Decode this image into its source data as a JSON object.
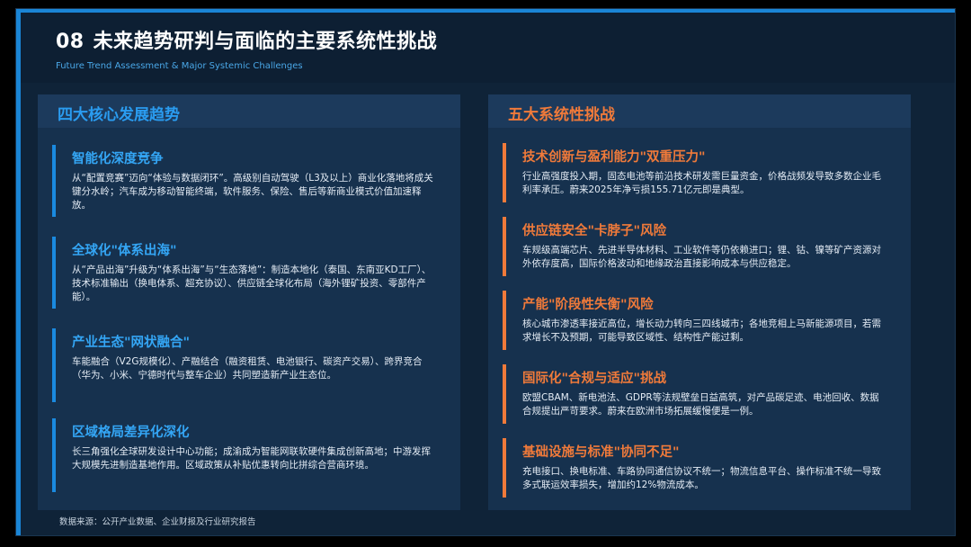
{
  "header": {
    "number": "08",
    "title": "未来趋势研判与面临的主要系统性挑战",
    "subtitle": "Future Trend Assessment & Major Systemic Challenges"
  },
  "trends": {
    "title": "四大核心发展趋势",
    "items": [
      {
        "title": "智能化深度竞争",
        "desc": "从“配置竞赛”迈向“体验与数据闭环”。高级别自动驾驶（L3及以上）商业化落地将成关键分水岭；汽车成为移动智能终端，软件服务、保险、售后等新商业模式价值加速释放。"
      },
      {
        "title": "全球化\"体系出海\"",
        "desc": "从“产品出海”升级为“体系出海”与“生态落地”：制造本地化（泰国、东南亚KD工厂）、技术标准输出（换电体系、超充协议）、供应链全球化布局（海外锂矿投资、零部件产能）。"
      },
      {
        "title": "产业生态\"网状融合\"",
        "desc": "车能融合（V2G规模化）、产融结合（融资租赁、电池银行、碳资产交易）、跨界竞合（华为、小米、宁德时代与整车企业）共同塑造新产业生态位。"
      },
      {
        "title": "区域格局差异化深化",
        "desc": "长三角强化全球研发设计中心功能；成渝成为智能网联软硬件集成创新高地；中游发挥大规模先进制造基地作用。区域政策从补贴优惠转向比拼综合营商环境。"
      }
    ]
  },
  "challenges": {
    "title": "五大系统性挑战",
    "items": [
      {
        "title": "技术创新与盈利能力\"双重压力\"",
        "desc": "行业高强度投入期，固态电池等前沿技术研发需巨量资金，价格战频发导致多数企业毛利率承压。蔚来2025年净亏损155.71亿元即是典型。"
      },
      {
        "title": "供应链安全\"卡脖子\"风险",
        "desc": "车规级高端芯片、先进半导体材料、工业软件等仍依赖进口；锂、钴、镍等矿产资源对外依存度高，国际价格波动和地缘政治直接影响成本与供应稳定。"
      },
      {
        "title": "产能\"阶段性失衡\"风险",
        "desc": "核心城市渗透率接近高位，增长动力转向三四线城市；各地竞相上马新能源项目，若需求增长不及预期，可能导致区域性、结构性产能过剩。"
      },
      {
        "title": "国际化\"合规与适应\"挑战",
        "desc": "欧盟CBAM、新电池法、GDPR等法规壁垒日益高筑，对产品碳足迹、电池回收、数据合规提出严苛要求。蔚来在欧洲市场拓展缓慢便是一例。"
      },
      {
        "title": "基础设施与标准\"协同不足\"",
        "desc": "充电接口、换电标准、车路协同通信协议不统一；物流信息平台、操作标准不统一导致多式联运效率损失，增加约12%物流成本。"
      }
    ]
  },
  "source": "数据来源：公开产业数据、企业财报及行业研究报告",
  "colors": {
    "background": "#0f2338",
    "accent_blue": "#1a85d6",
    "accent_orange": "#f07a3a",
    "panel": "#16314e"
  }
}
